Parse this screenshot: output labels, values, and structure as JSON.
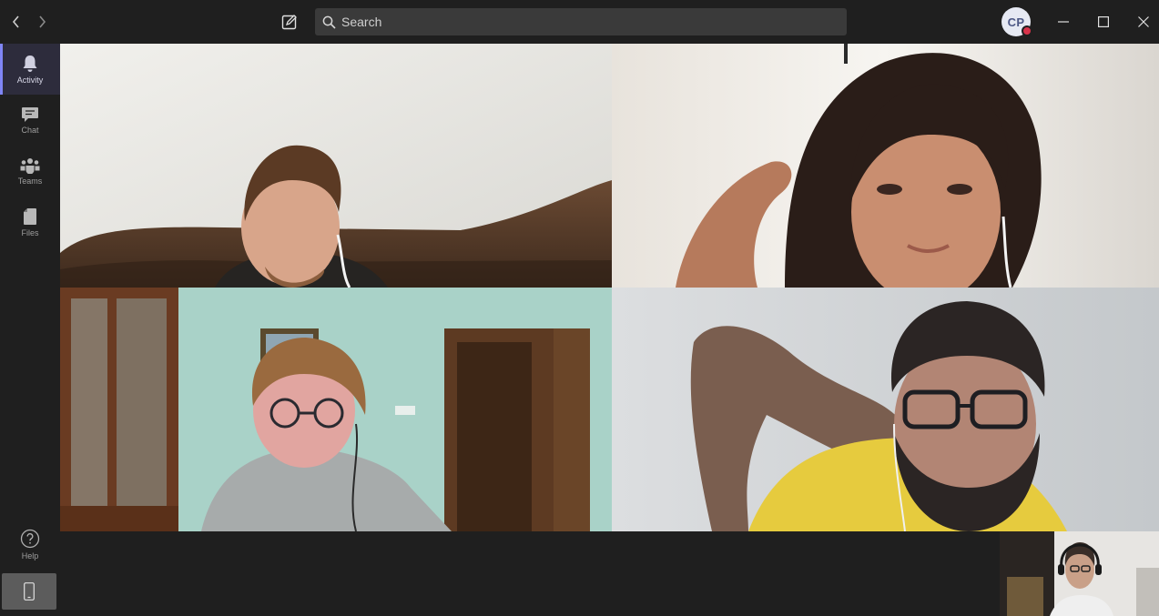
{
  "search": {
    "placeholder": "Search"
  },
  "user": {
    "initials": "CP",
    "status": "busy"
  },
  "rail": {
    "items": [
      {
        "label": "Activity",
        "icon": "bell-icon"
      },
      {
        "label": "Chat",
        "icon": "chat-icon"
      },
      {
        "label": "Teams",
        "icon": "teams-icon"
      },
      {
        "label": "Files",
        "icon": "file-icon"
      }
    ],
    "help_label": "Help"
  },
  "colors": {
    "accent": "#7f85f5",
    "presence_busy": "#d8334a",
    "background": "#1f1f1f"
  }
}
